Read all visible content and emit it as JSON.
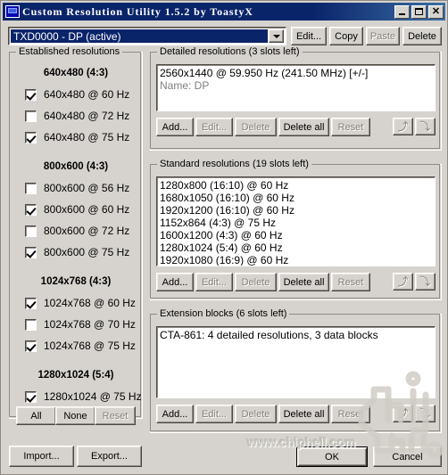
{
  "window": {
    "title": "Custom Resolution Utility 1.5.2 by ToastyX",
    "icon": "monitor-icon",
    "minimize_label": "_",
    "maximize_label": "□",
    "close_label": "✕"
  },
  "display_selector": {
    "value": "TXD0000 - DP (active)",
    "arrow": "chevron-down-icon",
    "buttons": [
      {
        "label": "Edit...",
        "disabled": false
      },
      {
        "label": "Copy",
        "disabled": false
      },
      {
        "label": "Paste",
        "disabled": true
      },
      {
        "label": "Delete",
        "disabled": false
      }
    ]
  },
  "established": {
    "title": "Established resolutions",
    "groups": [
      {
        "heading": "640x480 (4:3)",
        "items": [
          {
            "label": "640x480 @ 60 Hz",
            "checked": true
          },
          {
            "label": "640x480 @ 72 Hz",
            "checked": false
          },
          {
            "label": "640x480 @ 75 Hz",
            "checked": true
          }
        ]
      },
      {
        "heading": "800x600 (4:3)",
        "items": [
          {
            "label": "800x600 @ 56 Hz",
            "checked": false
          },
          {
            "label": "800x600 @ 60 Hz",
            "checked": true
          },
          {
            "label": "800x600 @ 72 Hz",
            "checked": false
          },
          {
            "label": "800x600 @ 75 Hz",
            "checked": true
          }
        ]
      },
      {
        "heading": "1024x768 (4:3)",
        "items": [
          {
            "label": "1024x768 @ 60 Hz",
            "checked": true
          },
          {
            "label": "1024x768 @ 70 Hz",
            "checked": false
          },
          {
            "label": "1024x768 @ 75 Hz",
            "checked": true
          }
        ]
      },
      {
        "heading": "1280x1024 (5:4)",
        "items": [
          {
            "label": "1280x1024 @ 75 Hz",
            "checked": true
          }
        ]
      }
    ],
    "buttons": [
      {
        "label": "All",
        "disabled": false
      },
      {
        "label": "None",
        "disabled": false
      },
      {
        "label": "Reset",
        "disabled": true
      }
    ]
  },
  "detailed": {
    "title": "Detailed resolutions (3 slots left)",
    "rows": [
      {
        "text": "2560x1440 @ 59.950 Hz (241.50 MHz) [+/-]",
        "muted": false
      },
      {
        "text": "Name: DP",
        "muted": true
      }
    ],
    "buttons": [
      {
        "label": "Add...",
        "disabled": false
      },
      {
        "label": "Edit...",
        "disabled": true
      },
      {
        "label": "Delete",
        "disabled": true
      },
      {
        "label": "Delete all",
        "disabled": false
      },
      {
        "label": "Reset",
        "disabled": true
      }
    ],
    "move_up": "⤴",
    "move_down": "⤵"
  },
  "standard": {
    "title": "Standard resolutions (19 slots left)",
    "rows": [
      {
        "text": "1280x800 (16:10) @ 60 Hz",
        "muted": false
      },
      {
        "text": "1680x1050 (16:10) @ 60 Hz",
        "muted": false
      },
      {
        "text": "1920x1200 (16:10) @ 60 Hz",
        "muted": false
      },
      {
        "text": "1152x864 (4:3) @ 75 Hz",
        "muted": false
      },
      {
        "text": "1600x1200 (4:3) @ 60 Hz",
        "muted": false
      },
      {
        "text": "1280x1024 (5:4) @ 60 Hz",
        "muted": false
      },
      {
        "text": "1920x1080 (16:9) @ 60 Hz",
        "muted": false
      }
    ],
    "buttons": [
      {
        "label": "Add...",
        "disabled": false
      },
      {
        "label": "Edit...",
        "disabled": true
      },
      {
        "label": "Delete",
        "disabled": true
      },
      {
        "label": "Delete all",
        "disabled": false
      },
      {
        "label": "Reset",
        "disabled": true
      }
    ],
    "move_up": "⤴",
    "move_down": "⤵"
  },
  "extension": {
    "title": "Extension blocks (6 slots left)",
    "rows": [
      {
        "text": "CTA-861: 4 detailed resolutions, 3 data blocks",
        "muted": false
      }
    ],
    "buttons": [
      {
        "label": "Add...",
        "disabled": false
      },
      {
        "label": "Edit...",
        "disabled": true
      },
      {
        "label": "Delete",
        "disabled": true
      },
      {
        "label": "Delete all",
        "disabled": false
      },
      {
        "label": "Reset",
        "disabled": true
      }
    ],
    "move_up": "⤴",
    "move_down": "⤵"
  },
  "footer": {
    "import_label": "Import...",
    "export_label": "Export...",
    "ok_label": "OK",
    "cancel_label": "Cancel"
  },
  "watermark": {
    "text": "www.chiphell.com",
    "logo": "chiphell-logo"
  },
  "colors": {
    "face": "#d6d3ce",
    "title_active": "#0a246a",
    "selection": "#0a246a",
    "disabled_text": "#868079",
    "muted_text": "#808080"
  }
}
